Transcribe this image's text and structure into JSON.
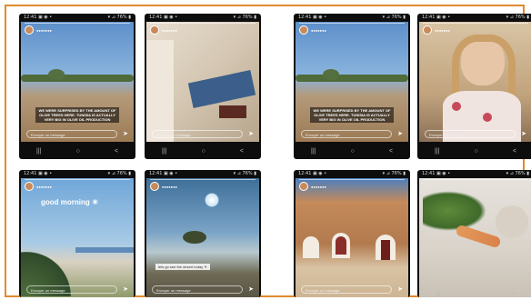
{
  "status_bar": {
    "left": "12:41 ▣ ◉ •",
    "right": "▾ ⊿ 76% ▮"
  },
  "reply_placeholder": "Envoyer un message",
  "nav": [
    "|||",
    "○",
    "<"
  ],
  "captions": {
    "olive": "WE WERE SURPRISED BY THE AMOUNT OF OLIVE TREES HERE. TUNISIA IS ACTUALLY VERY BIG IN OLIVE OIL PRODUCTION",
    "morning": "good morning ☀",
    "sky": "lets go see the desert today ☀"
  },
  "colors": {
    "border": "#e08a2c"
  }
}
